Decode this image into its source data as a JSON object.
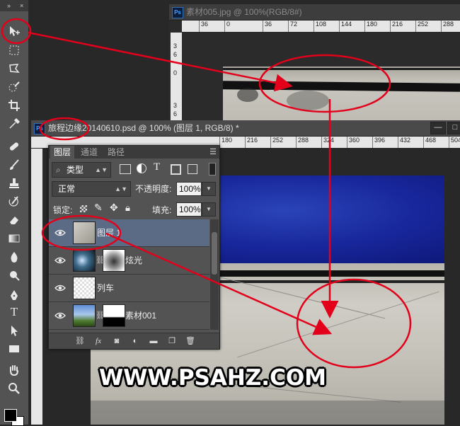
{
  "toolbar": {
    "collapse_glyph": "»",
    "close_glyph": "×",
    "tools": [
      "move-tool",
      "marquee-tool",
      "lasso-tool",
      "quick-select-tool",
      "crop-tool",
      "eyedropper-tool",
      "healing-brush-tool",
      "brush-tool",
      "clone-stamp-tool",
      "history-brush-tool",
      "eraser-tool",
      "gradient-tool",
      "blur-tool",
      "dodge-tool",
      "pen-tool",
      "type-tool",
      "path-select-tool",
      "rectangle-tool",
      "hand-tool",
      "zoom-tool"
    ],
    "type_glyph": "T",
    "foreground_color": "#000000",
    "background_color": "#ffffff"
  },
  "doc_back": {
    "ps_badge": "Ps",
    "title": "素材005.jpg @ 100%(RGB/8#)",
    "ruler_h": [
      "36",
      "0",
      "36",
      "72",
      "108",
      "144",
      "180",
      "216",
      "252",
      "288"
    ],
    "ruler_v": [
      "3",
      "6",
      "0",
      "3",
      "6"
    ]
  },
  "doc_front": {
    "ps_badge": "Ps",
    "title": "旅程边缘20140610.psd @ 100% (图层 1, RGB/8) *",
    "minimize": "—",
    "maximize": "□",
    "ruler_h": [
      "180",
      "216",
      "252",
      "288",
      "324",
      "360",
      "396",
      "432",
      "468",
      "504"
    ]
  },
  "layers_panel": {
    "tabs": [
      "图层",
      "通道",
      "路径"
    ],
    "filter_label": "类型",
    "blend_mode": "正常",
    "opacity_label": "不透明度:",
    "opacity_value": "100%",
    "lock_label": "锁定:",
    "fill_label": "填充:",
    "fill_value": "100%",
    "layers": [
      {
        "name": "图层 1",
        "selected": true
      },
      {
        "name": "炫光",
        "selected": false
      },
      {
        "name": "列车",
        "selected": false
      },
      {
        "name": "素材001",
        "selected": false
      }
    ],
    "footer_fx": "fx"
  },
  "watermark": "WWW.PSAHZ.COM",
  "annotation_color": "#e3001b"
}
